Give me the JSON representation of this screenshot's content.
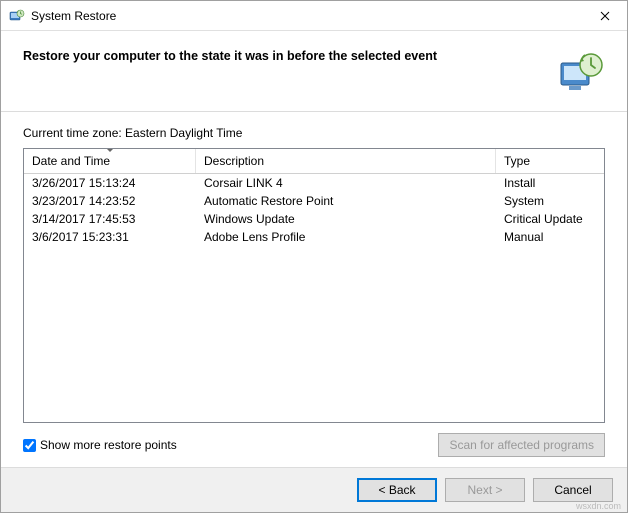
{
  "titlebar": {
    "title": "System Restore"
  },
  "header": {
    "heading": "Restore your computer to the state it was in before the selected event"
  },
  "content": {
    "timezone_label": "Current time zone: Eastern Daylight Time",
    "columns": {
      "date": "Date and Time",
      "desc": "Description",
      "type": "Type"
    },
    "rows": [
      {
        "date": "3/26/2017 15:13:24",
        "desc": "Corsair LINK 4",
        "type": "Install"
      },
      {
        "date": "3/23/2017 14:23:52",
        "desc": "Automatic Restore Point",
        "type": "System"
      },
      {
        "date": "3/14/2017 17:45:53",
        "desc": "Windows Update",
        "type": "Critical Update"
      },
      {
        "date": "3/6/2017 15:23:31",
        "desc": "Adobe Lens Profile",
        "type": "Manual"
      }
    ],
    "show_more_label": "Show more restore points",
    "show_more_checked": true,
    "scan_label": "Scan for affected programs"
  },
  "footer": {
    "back": "< Back",
    "next": "Next >",
    "cancel": "Cancel"
  },
  "watermark": "wsxdn.com"
}
